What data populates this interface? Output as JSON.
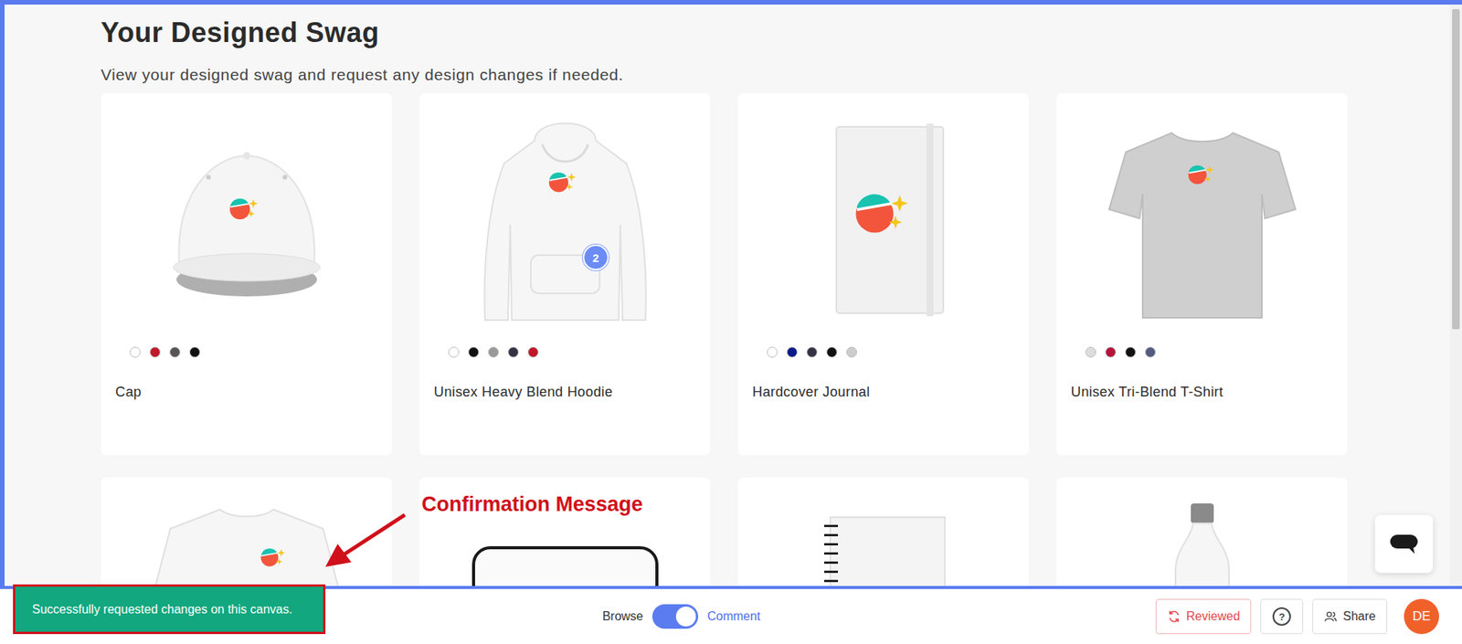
{
  "page": {
    "title": "Your Designed Swag",
    "subtitle": "View your designed swag and request any design changes if needed."
  },
  "products": [
    {
      "kind": "cap",
      "name": "Cap",
      "colors": [
        "#ffffff",
        "#c0182b",
        "#555555",
        "#111111"
      ]
    },
    {
      "kind": "hoodie",
      "name": "Unisex Heavy Blend Hoodie",
      "colors": [
        "#ffffff",
        "#111111",
        "#999999",
        "#333344",
        "#c0182b"
      ],
      "comment_badge": "2"
    },
    {
      "kind": "journal",
      "name": "Hardcover Journal",
      "colors": [
        "#ffffff",
        "#0a1a8a",
        "#333344",
        "#111111",
        "#cccccc"
      ]
    },
    {
      "kind": "tshirt",
      "name": "Unisex Tri-Blend T-Shirt",
      "colors": [
        "#dddddd",
        "#b8123a",
        "#111111",
        "#555b80"
      ]
    },
    {
      "kind": "sweatshirt",
      "name": "",
      "colors": []
    },
    {
      "kind": "laptop-sleeve",
      "name": "",
      "colors": []
    },
    {
      "kind": "notebook",
      "name": "",
      "colors": []
    },
    {
      "kind": "bottle",
      "name": "",
      "colors": []
    }
  ],
  "scrollbar": {
    "level": 0.56
  },
  "annotation": {
    "label": "Confirmation Message"
  },
  "toast": {
    "text": "Successfully requested changes on this canvas."
  },
  "toggle": {
    "left": "Browse",
    "right": "Comment",
    "on": true
  },
  "actions": {
    "reviewed": "Reviewed",
    "help": "?",
    "share": "Share",
    "avatar": "DE"
  }
}
